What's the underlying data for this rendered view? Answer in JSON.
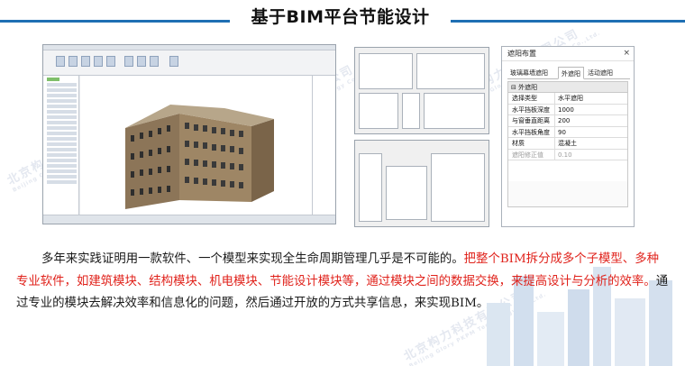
{
  "title": "基于BIM平台节能设计",
  "body": {
    "part1": "多年来实践证明用一款软件、一个模型来实现全生命周期管理几乎是不可能的。",
    "part2_red": "把整个BIM拆分成多个子模型、多种专业软件，如建筑模块、结构模块、机电模块、节能设计模块等，通过模块之间的数据交换，来提高设计与分析的效率。",
    "part3": "通过专业的模块去解决效率和信息化的问题，然后通过开放的方式共享信息，来实现BIM。"
  },
  "props_dialog": {
    "title": "遮阳布置",
    "close": "×",
    "tabs": [
      "玻璃幕墙遮阳",
      "外遮阳",
      "活动遮阳"
    ],
    "active_tab": "外遮阳",
    "section": "外遮阳",
    "rows": [
      {
        "key": "选择类型",
        "value": "水平遮阳"
      },
      {
        "key": "水平挡板深度",
        "value": "1000"
      },
      {
        "key": "与窗垂直距离",
        "value": "200"
      },
      {
        "key": "水平挡板角度",
        "value": "90"
      },
      {
        "key": "材质",
        "value": "混凝土"
      },
      {
        "key": "遮阳修正值",
        "value": "0.10"
      }
    ]
  },
  "colors": {
    "accent_line": "#1f6fb3",
    "highlight_text": "#e0221b",
    "building_wall": "#8c7558",
    "building_window": "#3a3a3a"
  },
  "icons": {
    "close": "close-icon",
    "building": "building-3d-model"
  }
}
